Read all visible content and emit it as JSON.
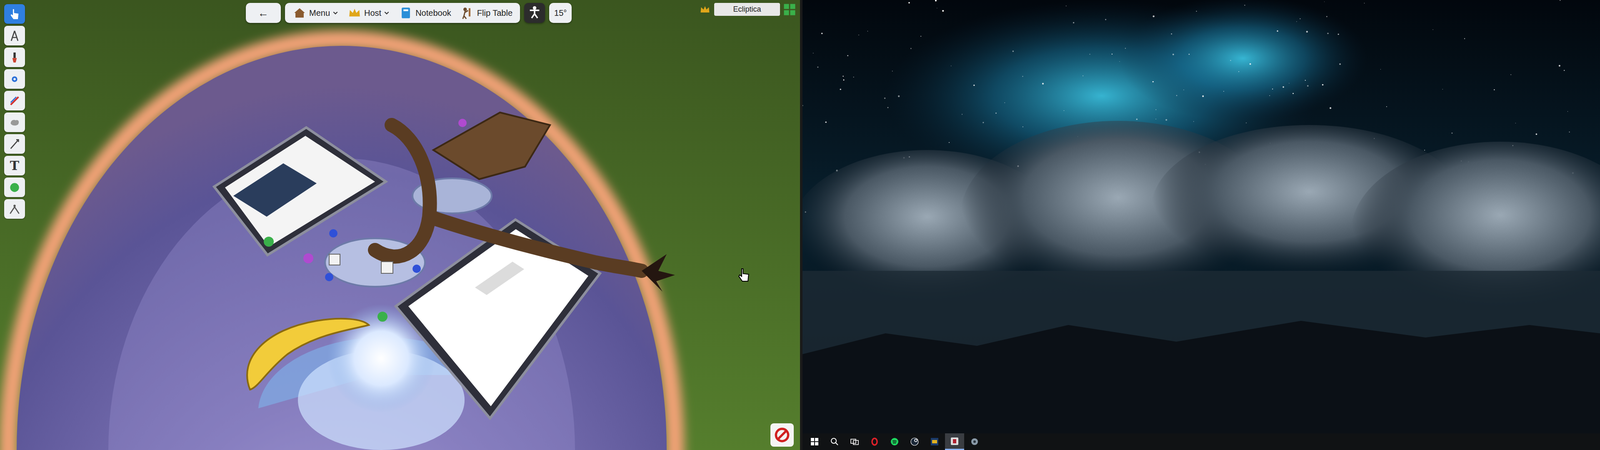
{
  "game_toolbar": {
    "back": "←",
    "menu_items": [
      {
        "label": "Menu",
        "dropdown": true
      },
      {
        "label": "Host",
        "dropdown": true
      },
      {
        "label": "Notebook",
        "dropdown": false
      },
      {
        "label": "Flip Table",
        "dropdown": false
      }
    ],
    "rotation": "15°"
  },
  "player": {
    "name": "Ecliptica"
  },
  "tools": [
    {
      "kind": "icon",
      "selected": true
    },
    {
      "kind": "icon",
      "selected": false
    },
    {
      "kind": "icon",
      "selected": false
    },
    {
      "kind": "icon",
      "selected": false
    },
    {
      "kind": "icon",
      "selected": false
    },
    {
      "kind": "icon",
      "selected": false
    },
    {
      "kind": "icon",
      "selected": false
    },
    {
      "kind": "text",
      "label": "T",
      "selected": false
    },
    {
      "kind": "icon",
      "selected": false
    },
    {
      "kind": "icon",
      "selected": false
    }
  ],
  "taskbar": {
    "items": [
      {
        "active": false
      },
      {
        "active": false
      },
      {
        "active": false
      },
      {
        "active": false
      },
      {
        "active": false
      },
      {
        "active": false
      },
      {
        "active": false
      },
      {
        "active": true
      },
      {
        "active": false
      }
    ]
  }
}
